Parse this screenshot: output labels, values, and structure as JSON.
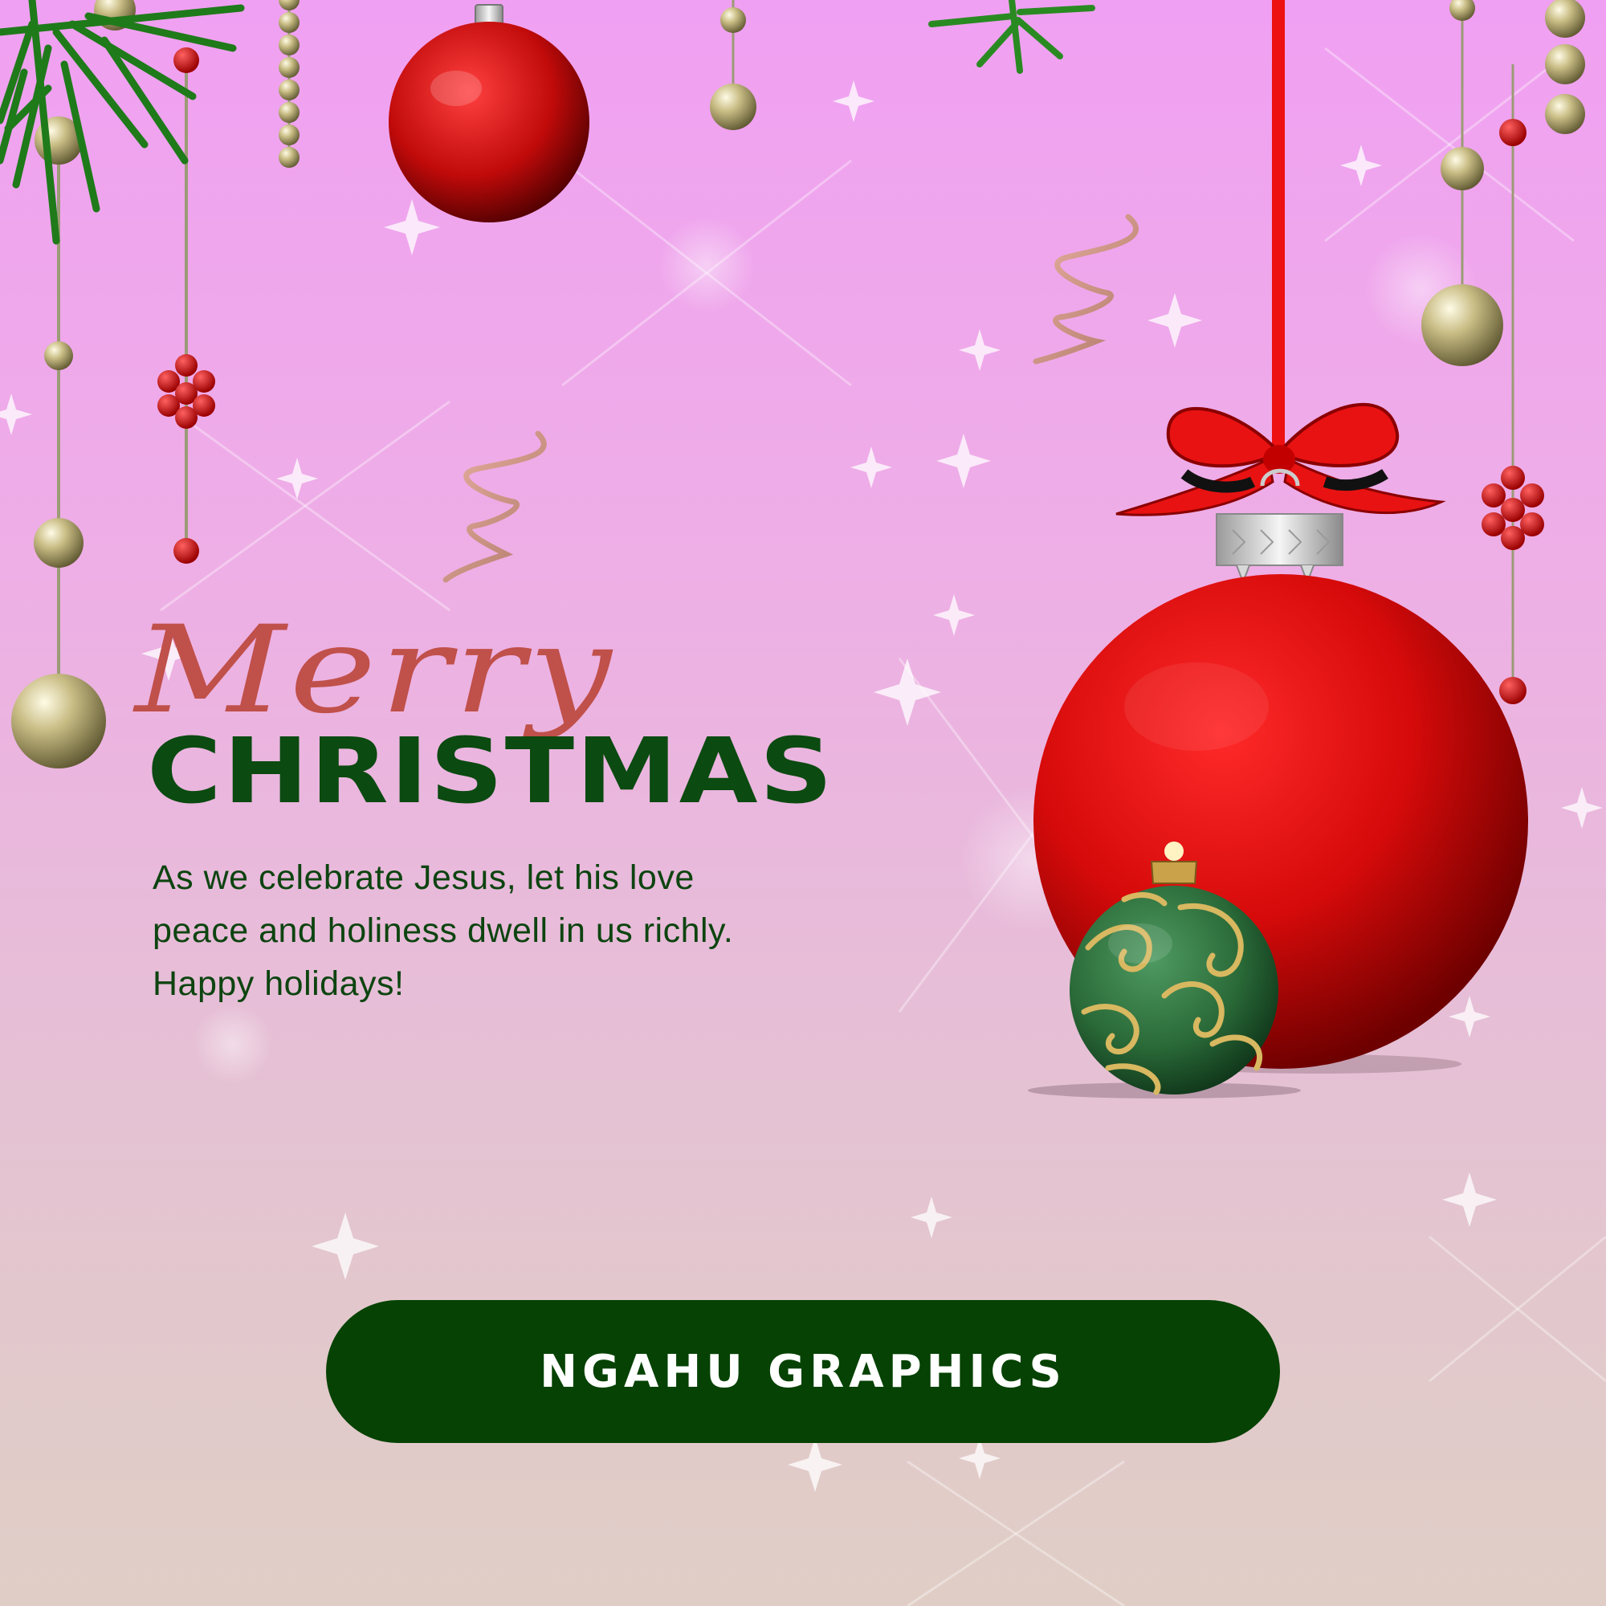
{
  "card": {
    "greeting_script": "Merry",
    "greeting_title": "CHRISTMAS",
    "message_lines": [
      "As we celebrate Jesus, let his love",
      "peace and holiness dwell in us richly.",
      "Happy holidays!"
    ],
    "brand_label": "NGAHU GRAPHICS"
  },
  "colors": {
    "background_top": "#f0a0f2",
    "background_bottom": "#e0cec6",
    "title_green": "#0b4a10",
    "script_red": "#c0504a",
    "button_green": "#054203",
    "ornament_red": "#d60a0a",
    "ornament_green": "#2a6a38",
    "gold": "#b7a86a"
  },
  "icons": [
    "large-red-ornament-icon",
    "red-disco-ball-icon",
    "green-gold-ornament-icon",
    "pine-branch-icon",
    "gold-bead-icon",
    "red-berry-cluster-icon",
    "ribbon-curl-icon",
    "sparkle-icon"
  ]
}
